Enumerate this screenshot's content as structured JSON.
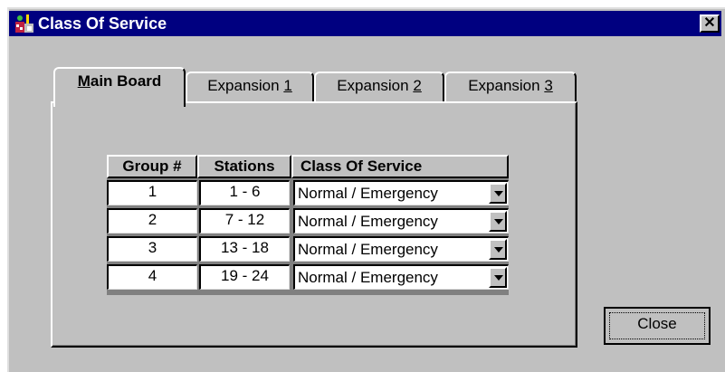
{
  "window": {
    "title": "Class Of Service",
    "close_glyph": "✕",
    "icon": "app-icon"
  },
  "tabs": [
    {
      "prefix": "",
      "mnemonic": "M",
      "suffix": "ain Board",
      "active": true
    },
    {
      "prefix": "Expansion ",
      "mnemonic": "1",
      "suffix": "",
      "active": false
    },
    {
      "prefix": "Expansion ",
      "mnemonic": "2",
      "suffix": "",
      "active": false
    },
    {
      "prefix": "Expansion ",
      "mnemonic": "3",
      "suffix": "",
      "active": false
    }
  ],
  "table": {
    "headers": [
      "Group #",
      "Stations",
      "Class Of Service"
    ],
    "rows": [
      {
        "group": "1",
        "stations": "1 - 6",
        "class_of_service": "Normal / Emergency"
      },
      {
        "group": "2",
        "stations": "7 - 12",
        "class_of_service": "Normal / Emergency"
      },
      {
        "group": "3",
        "stations": "13 - 18",
        "class_of_service": "Normal / Emergency"
      },
      {
        "group": "4",
        "stations": "19 - 24",
        "class_of_service": "Normal / Emergency"
      }
    ]
  },
  "buttons": {
    "close_label": "Close"
  }
}
